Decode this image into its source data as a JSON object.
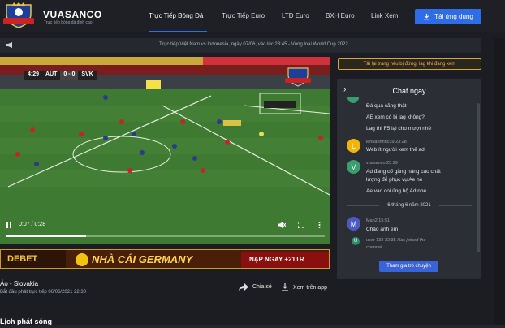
{
  "brand": {
    "name": "VUASANCO",
    "tagline": "Trực tiếp bóng đá đỉnh cao",
    "badge_text": "VUASANCO"
  },
  "nav": [
    {
      "label": "Trực Tiếp Bóng Đá",
      "active": true
    },
    {
      "label": "Trực Tiếp Euro",
      "active": false
    },
    {
      "label": "LTĐ Euro",
      "active": false
    },
    {
      "label": "BXH Euro",
      "active": false
    },
    {
      "label": "Link Xem",
      "active": false
    }
  ],
  "download_button": {
    "label": "Tải ứng dụng",
    "icon": "download-icon"
  },
  "ticker": {
    "icon": "megaphone-icon",
    "text": "Trực tiếp Việt Nam vs Indonesia, ngày 07/06, vào lúc 23:45 - Vòng loại World Cup 2022"
  },
  "player": {
    "scoreboard": {
      "time": "4:29",
      "home": "AUT",
      "score": "0 - 0",
      "away": "SVK"
    },
    "time_display": "0:07 / 0:28",
    "progress": 0.25,
    "controls": [
      "play-icon",
      "volume-icon",
      "fullscreen-icon",
      "more-options-icon"
    ]
  },
  "banner": {
    "left": "DEBET",
    "center": "NHÀ CÁI GERMANY",
    "right": "NẠP NGAY +21TR"
  },
  "match": {
    "title": "Áo - Slovakia",
    "subtitle": "Bắt đầu phát trực tiếp 06/06/2021 22:30",
    "share_label": "Chia sẻ",
    "watch_app_label": "Xem trên app"
  },
  "schedule_heading": "Lịch phát sóng",
  "warning": "Tải lại trang nếu bị đứng, lag khi đang xem",
  "chat": {
    "title": "Chat ngay",
    "messages": [
      {
        "text": "Đá quá căng thật"
      },
      {
        "text": "AE xem có bị lag không?."
      },
      {
        "text": "Lag thì F5 lại cho mượt nhé"
      },
      {
        "user": "lehuannnhc39",
        "time": "23:28",
        "text": "Web ít người xem thế ad",
        "avatar": "L",
        "color": "#f5b400"
      },
      {
        "user": "vuasanco",
        "time": "23:29",
        "text": "Ad đang cố gắng nâng cao chất",
        "text2": "lượng để phục vụ Ae nè",
        "avatar": "V",
        "color": "#3a9d6e"
      },
      {
        "text": "Ae vào coi ủng hộ Ad nhé"
      }
    ],
    "date_divider": "6 tháng 6 năm 2021",
    "later": [
      {
        "user": "Man2",
        "time": "15:51",
        "text": "Chào anh em",
        "avatar": "M",
        "color": "#4a5bbf"
      },
      {
        "user": "user 132",
        "time": "22:35",
        "text": "Has joined the",
        "text2": "channel.",
        "avatar": "U",
        "color": "#2f8f6a"
      }
    ],
    "join_button": "Tham gia trò chuyện"
  }
}
